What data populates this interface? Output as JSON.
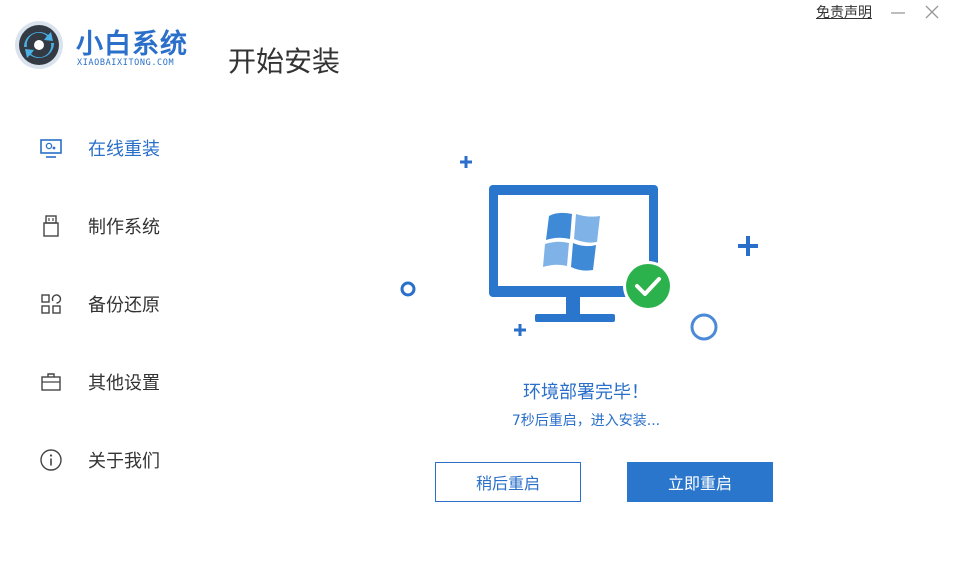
{
  "header": {
    "brand_name": "小白系统",
    "brand_sub": "XIAOBAIXITONG.COM",
    "page_title": "开始安装",
    "disclaimer": "免责声明"
  },
  "sidebar": {
    "items": [
      {
        "label": "在线重装",
        "icon": "monitor-icon",
        "active": true
      },
      {
        "label": "制作系统",
        "icon": "usb-drive-icon",
        "active": false
      },
      {
        "label": "备份还原",
        "icon": "grid-restore-icon",
        "active": false
      },
      {
        "label": "其他设置",
        "icon": "briefcase-icon",
        "active": false
      },
      {
        "label": "关于我们",
        "icon": "info-icon",
        "active": false
      }
    ]
  },
  "main": {
    "status_title": "环境部署完毕！",
    "status_sub": "7秒后重启，进入安装...",
    "btn_later": "稍后重启",
    "btn_now": "立即重启"
  },
  "colors": {
    "accent": "#2a6fc9",
    "button_primary": "#2a76cc",
    "success": "#2bb24c"
  }
}
